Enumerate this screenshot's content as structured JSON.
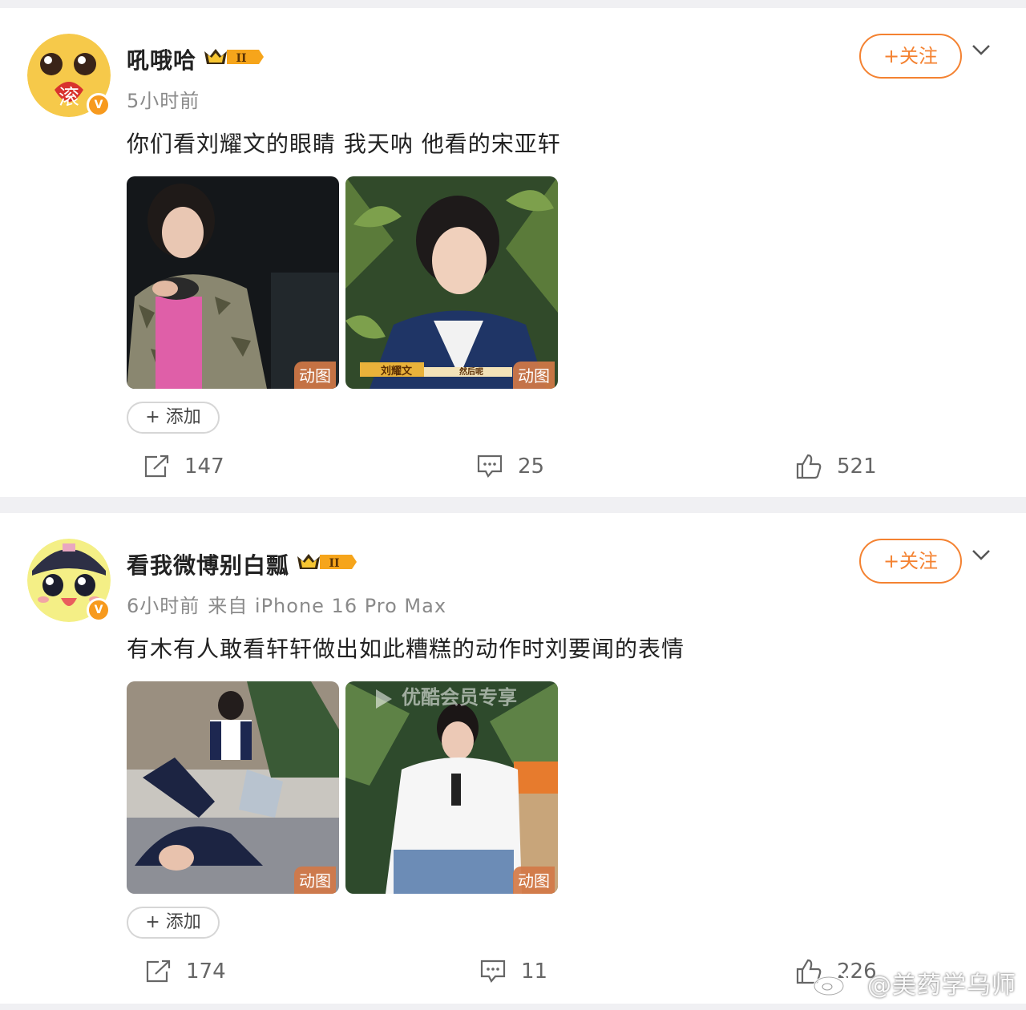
{
  "posts": [
    {
      "username": "吼哦哈",
      "level_badge": "II",
      "avatar_text": "滚",
      "time": "5小时前",
      "source": "",
      "text": "你们看刘耀文的眼睛 我天呐 他看的宋亚轩",
      "follow_label": "+关注",
      "add_label": "+ 添加",
      "images": [
        {
          "badge": "动图",
          "caption": ""
        },
        {
          "badge": "动图",
          "caption": "刘耀文",
          "caption2": "然后呢"
        }
      ],
      "reposts": "147",
      "comments": "25",
      "likes": "521"
    },
    {
      "username": "看我微博别白瓢",
      "level_badge": "II",
      "avatar_text": "",
      "time": "6小时前",
      "source": "来自 iPhone 16 Pro Max",
      "text": "有木有人敢看轩轩做出如此糟糕的动作时刘要闻的表情",
      "follow_label": "+关注",
      "add_label": "+ 添加",
      "images": [
        {
          "badge": "动图",
          "caption": ""
        },
        {
          "badge": "动图",
          "caption": "优酷会员专享"
        }
      ],
      "reposts": "174",
      "comments": "11",
      "likes": "226"
    }
  ],
  "watermark": "@美药学乌师",
  "colors": {
    "accent": "#f48231",
    "page_bg": "#f0f0f3",
    "verified": "#f79a1e"
  }
}
